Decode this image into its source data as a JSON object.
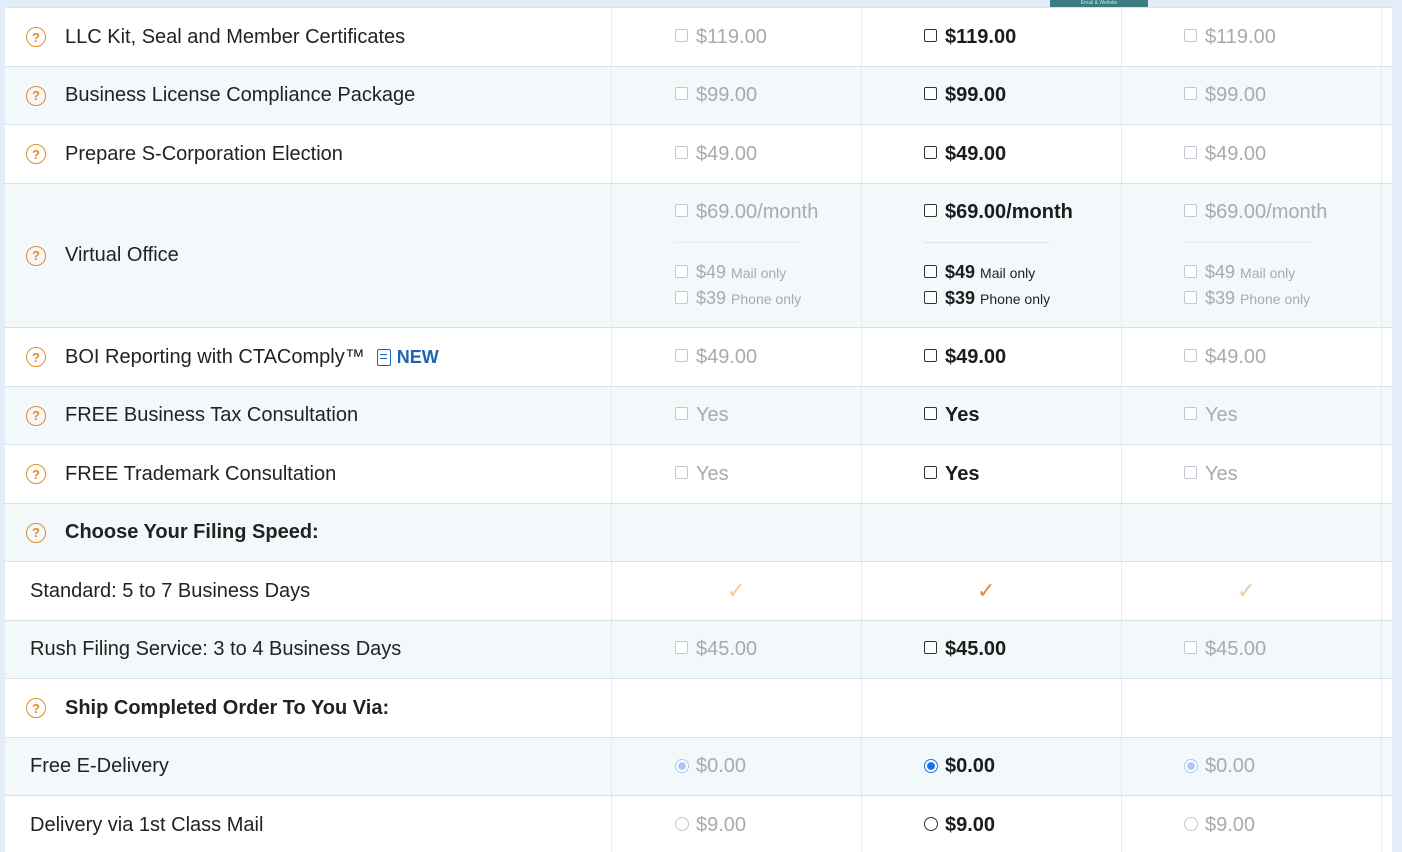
{
  "top_tab": "Email & Website",
  "rows": [
    {
      "label": "LLC Kit, Seal and Member Certificates",
      "values": [
        "$119.00",
        "$119.00",
        "$119.00"
      ]
    },
    {
      "label": "Business License Compliance Package",
      "values": [
        "$99.00",
        "$99.00",
        "$99.00"
      ]
    },
    {
      "label": "Prepare S-Corporation Election",
      "values": [
        "$49.00",
        "$49.00",
        "$49.00"
      ]
    },
    {
      "label": "Virtual Office",
      "values": [
        "$69.00/month",
        "$69.00/month",
        "$69.00/month"
      ],
      "sub_options": [
        {
          "price": "$49",
          "note": "Mail only"
        },
        {
          "price": "$39",
          "note": "Phone only"
        }
      ]
    },
    {
      "label": "BOI Reporting with CTAComply™",
      "badge": "NEW",
      "values": [
        "$49.00",
        "$49.00",
        "$49.00"
      ]
    },
    {
      "label": "FREE Business Tax Consultation",
      "values": [
        "Yes",
        "Yes",
        "Yes"
      ]
    },
    {
      "label": "FREE Trademark Consultation",
      "values": [
        "Yes",
        "Yes",
        "Yes"
      ]
    }
  ],
  "filing_speed": {
    "heading": "Choose Your Filing Speed:",
    "standard": {
      "label": "Standard: 5 to 7 Business Days",
      "check": "✓"
    },
    "rush": {
      "label": "Rush Filing Service: 3 to 4 Business Days",
      "values": [
        "$45.00",
        "$45.00",
        "$45.00"
      ]
    }
  },
  "shipping": {
    "heading": "Ship Completed Order To You Via:",
    "options": [
      {
        "label": "Free E-Delivery",
        "values": [
          "$0.00",
          "$0.00",
          "$0.00"
        ],
        "selected": true
      },
      {
        "label": "Delivery via 1st Class Mail",
        "values": [
          "$9.00",
          "$9.00",
          "$9.00"
        ],
        "selected": false
      }
    ]
  },
  "help_icon_glyph": "?",
  "colors": {
    "accent": "#e38b2c",
    "selected_radio": "#1a73e8",
    "new_badge": "#1f62b0"
  }
}
